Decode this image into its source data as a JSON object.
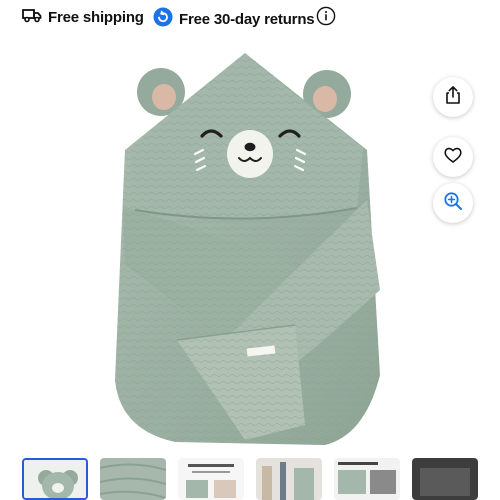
{
  "promos": {
    "shipping": {
      "label": "Free shipping",
      "icon": "truck-icon"
    },
    "returns": {
      "label": "Free 30-day returns",
      "icon": "return-arrow-icon"
    },
    "info_icon": "info-icon"
  },
  "product": {
    "image_alt": "Sage green muslin hooded baby towel with bear ears and face",
    "tag_text": "",
    "color": "#9bb0a3"
  },
  "actions": [
    {
      "name": "share",
      "icon": "share-icon"
    },
    {
      "name": "favorite",
      "icon": "heart-icon"
    },
    {
      "name": "zoom",
      "icon": "zoom-in-icon"
    }
  ],
  "thumbnails": {
    "selected_index": 0,
    "count_visible": 6
  },
  "colors": {
    "accent": "#1a73e8",
    "selected_border": "#2a5bd7",
    "towel": "#9bb0a3"
  }
}
